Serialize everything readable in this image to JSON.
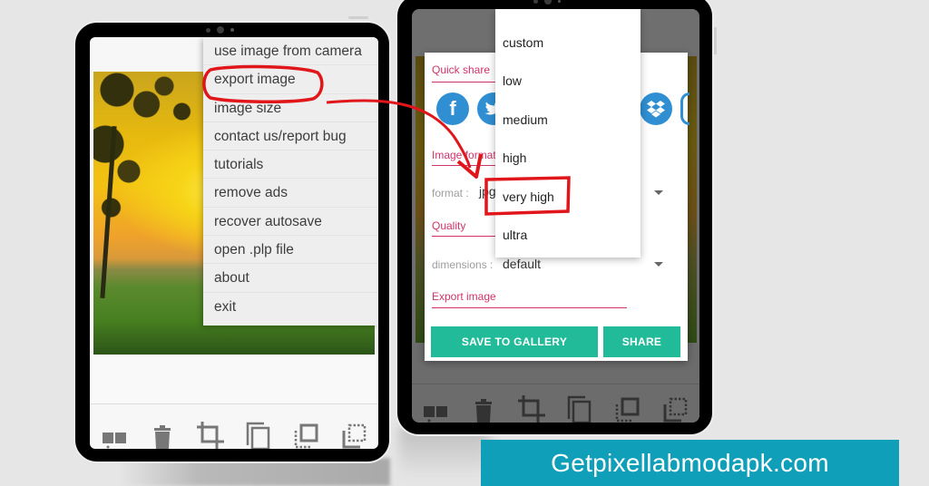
{
  "left_screen": {
    "overflow_menu": {
      "items": [
        {
          "label": "use image from camera"
        },
        {
          "label": "export image",
          "highlighted": true
        },
        {
          "label": "image size"
        },
        {
          "label": "contact us/report bug"
        },
        {
          "label": "tutorials"
        },
        {
          "label": "remove ads"
        },
        {
          "label": "recover autosave"
        },
        {
          "label": "open .plp file"
        },
        {
          "label": "about"
        },
        {
          "label": "exit"
        }
      ]
    },
    "toolbar": {
      "icons": [
        "layers-icon",
        "delete-icon",
        "crop-icon",
        "duplicate-icon",
        "select-front-icon",
        "select-back-icon"
      ]
    }
  },
  "right_screen": {
    "export_dialog": {
      "quick_share_label": "Quick share",
      "share_targets": [
        "facebook",
        "twitter",
        "dropbox"
      ],
      "image_format_label": "Image format",
      "format_field_label": "format :",
      "format_value": "jpg",
      "quality_label": "Quality",
      "dimensions_field_label": "dimensions :",
      "dimensions_value": "default",
      "export_image_label": "Export image",
      "save_button": "SAVE TO GALLERY",
      "share_button": "SHARE"
    },
    "quality_dropdown": {
      "options": [
        "custom",
        "low",
        "medium",
        "high",
        "very high",
        "ultra"
      ],
      "highlighted": "very high"
    }
  },
  "banner": {
    "text": "Getpixellabmodapk.com"
  },
  "colors": {
    "accent_pink": "#d1336b",
    "button_teal": "#22bb99",
    "banner_blue": "#109fb8",
    "share_blue": "#2f8fd2",
    "annotation_red": "#e0161b"
  }
}
